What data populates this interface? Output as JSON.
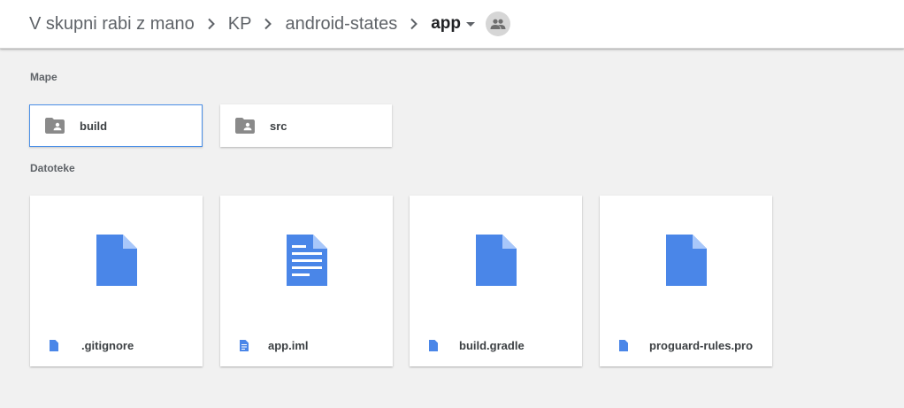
{
  "breadcrumb": {
    "items": [
      {
        "label": "V skupni rabi z mano"
      },
      {
        "label": "KP"
      },
      {
        "label": "android-states"
      }
    ],
    "current": "app",
    "shared_icon": "people-icon",
    "separator_icon": "chevron-right-icon",
    "dropdown_icon": "arrow-drop-down-icon"
  },
  "sections": {
    "folders_title": "Mape",
    "files_title": "Datoteke"
  },
  "folders": [
    {
      "name": "build",
      "icon": "shared-folder-icon",
      "selected": true
    },
    {
      "name": "src",
      "icon": "shared-folder-icon",
      "selected": false
    }
  ],
  "files": [
    {
      "name": ".gitignore",
      "icon": "file-icon",
      "preview": "generic-file-icon"
    },
    {
      "name": "app.iml",
      "icon": "document-icon",
      "preview": "text-document-icon"
    },
    {
      "name": "build.gradle",
      "icon": "file-icon",
      "preview": "generic-file-icon"
    },
    {
      "name": "proguard-rules.pro",
      "icon": "file-icon",
      "preview": "generic-file-icon"
    }
  ],
  "colors": {
    "accent_blue": "#4a86e8",
    "folder_grey": "#8a8a8a",
    "background": "#f1f1f1",
    "selection_border": "#4a8fe7"
  }
}
